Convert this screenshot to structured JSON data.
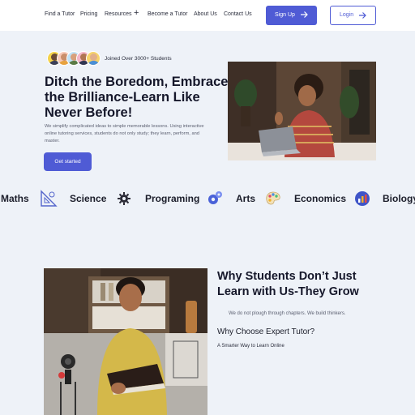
{
  "nav": {
    "links": [
      "Find a Tutor",
      "Pricing",
      "Resources",
      "Become a Tutor",
      "About Us",
      "Contact Us"
    ],
    "signup_label": "Sign Up",
    "login_label": "Login",
    "accent_color": "#4f5bd5"
  },
  "hero": {
    "joined_text": "Joined Over 3000+ Students",
    "title": "Ditch the Boredom, Embrace the Brilliance-Learn Like Never Before!",
    "description": "We simplify complicated ideas to simple memorable lessons. Using interactive online tutoring services, students do not only study; they learn, perform, and master.",
    "cta_label": "Get started"
  },
  "subjects": [
    "Maths",
    "Science",
    "Programing",
    "Arts",
    "Economics",
    "Biology"
  ],
  "why": {
    "title": "Why Students Don’t Just Learn with Us-They Grow",
    "subtitle": "We do not plough through chapters. We build thinkers.",
    "heading2": "Why Choose Expert Tutor?",
    "small_text": "A Smarter Way to Learn Online"
  }
}
